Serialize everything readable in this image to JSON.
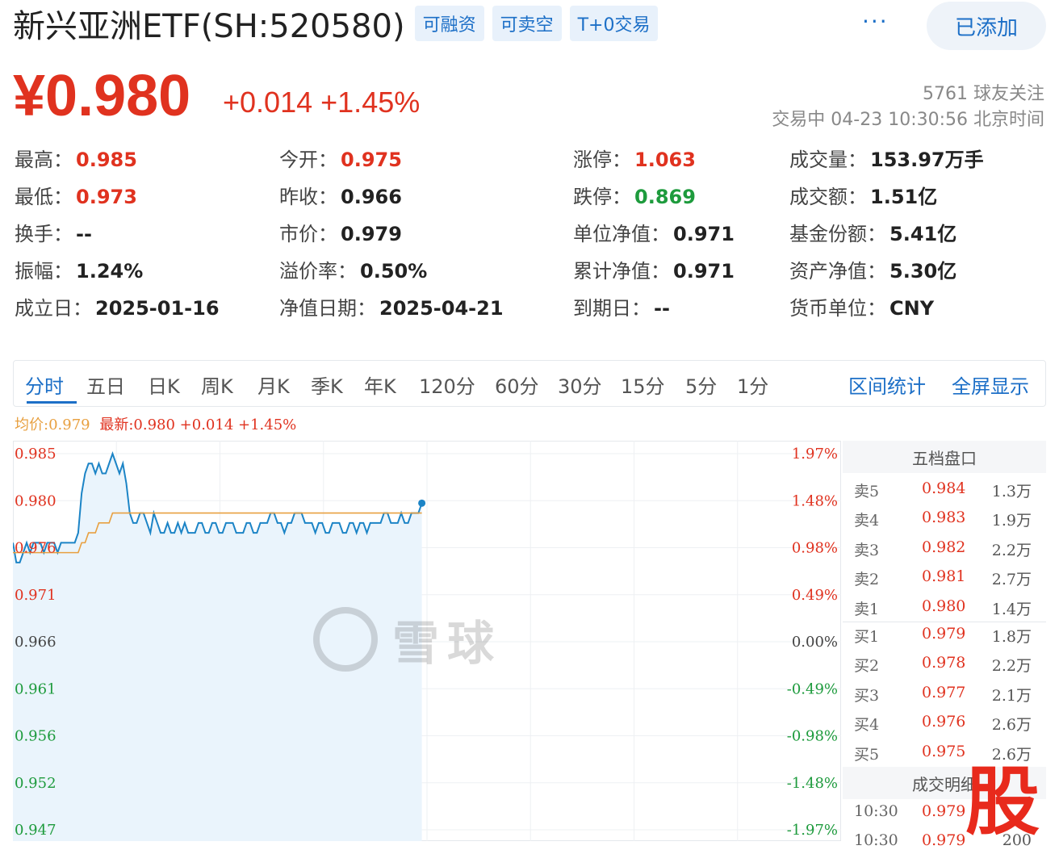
{
  "header": {
    "title": "新兴亚洲ETF(SH:520580)",
    "tags": [
      "可融资",
      "可卖空",
      "T+0交易"
    ],
    "more_label": "···",
    "follow_label": "已添加"
  },
  "quote": {
    "price": "¥0.980",
    "change": "+0.014",
    "change_pct": "+1.45%",
    "followers": "5761 球友关注",
    "status": "交易中 04-23 10:30:56 北京时间"
  },
  "stats": [
    {
      "label": "最高：",
      "value": "0.985",
      "tone": "red"
    },
    {
      "label": "今开：",
      "value": "0.975",
      "tone": "red"
    },
    {
      "label": "涨停：",
      "value": "1.063",
      "tone": "red"
    },
    {
      "label": "成交量：",
      "value": "153.97万手",
      "tone": ""
    },
    {
      "label": "最低：",
      "value": "0.973",
      "tone": "red"
    },
    {
      "label": "昨收：",
      "value": "0.966",
      "tone": ""
    },
    {
      "label": "跌停：",
      "value": "0.869",
      "tone": "green"
    },
    {
      "label": "成交额：",
      "value": "1.51亿",
      "tone": ""
    },
    {
      "label": "换手：",
      "value": "--",
      "tone": ""
    },
    {
      "label": "市价：",
      "value": "0.979",
      "tone": ""
    },
    {
      "label": "单位净值：",
      "value": "0.971",
      "tone": ""
    },
    {
      "label": "基金份额：",
      "value": "5.41亿",
      "tone": ""
    },
    {
      "label": "振幅：",
      "value": "1.24%",
      "tone": ""
    },
    {
      "label": "溢价率：",
      "value": "0.50%",
      "tone": ""
    },
    {
      "label": "累计净值：",
      "value": "0.971",
      "tone": ""
    },
    {
      "label": "资产净值：",
      "value": "5.30亿",
      "tone": ""
    },
    {
      "label": "成立日：",
      "value": "2025-01-16",
      "tone": ""
    },
    {
      "label": "净值日期：",
      "value": "2025-04-21",
      "tone": ""
    },
    {
      "label": "到期日：",
      "value": "--",
      "tone": ""
    },
    {
      "label": "货币单位：",
      "value": "CNY",
      "tone": ""
    }
  ],
  "tabs": [
    "分时",
    "五日",
    "日K",
    "周K",
    "月K",
    "季K",
    "年K",
    "120分",
    "60分",
    "30分",
    "15分",
    "5分",
    "1分"
  ],
  "active_tab": "分时",
  "right_tabs": [
    "区间统计",
    "全屏显示"
  ],
  "legend": {
    "avg": "均价:0.979",
    "latest": "最新:0.980 +0.014 +1.45%"
  },
  "chart_data": {
    "type": "line",
    "y_ticks_left": [
      "0.985",
      "0.980",
      "0.976",
      "0.971",
      "0.966",
      "0.961",
      "0.956",
      "0.952",
      "0.947"
    ],
    "y_ticks_right": [
      "1.97%",
      "1.48%",
      "0.98%",
      "0.49%",
      "0.00%",
      "-0.49%",
      "-0.98%",
      "-1.48%",
      "-1.97%"
    ],
    "ylim": [
      0.947,
      0.985
    ],
    "xlim": [
      0,
      241
    ],
    "baseline": 0.966,
    "tick_colors": {
      "up": "#e0321f",
      "flat": "#444444",
      "down": "#1e9b3d"
    },
    "series": [
      {
        "name": "最新",
        "color": "#1c84c6",
        "values": [
          0.976,
          0.974,
          0.974,
          0.975,
          0.976,
          0.975,
          0.976,
          0.976,
          0.976,
          0.975,
          0.976,
          0.976,
          0.976,
          0.975,
          0.976,
          0.976,
          0.976,
          0.976,
          0.976,
          0.977,
          0.981,
          0.983,
          0.984,
          0.984,
          0.983,
          0.984,
          0.983,
          0.983,
          0.984,
          0.985,
          0.984,
          0.983,
          0.984,
          0.982,
          0.979,
          0.978,
          0.978,
          0.979,
          0.979,
          0.978,
          0.977,
          0.979,
          0.978,
          0.977,
          0.977,
          0.978,
          0.977,
          0.977,
          0.978,
          0.977,
          0.978,
          0.977,
          0.977,
          0.977,
          0.978,
          0.978,
          0.977,
          0.977,
          0.978,
          0.978,
          0.977,
          0.977,
          0.978,
          0.978,
          0.978,
          0.977,
          0.977,
          0.977,
          0.978,
          0.978,
          0.977,
          0.977,
          0.978,
          0.978,
          0.978,
          0.979,
          0.979,
          0.978,
          0.978,
          0.977,
          0.978,
          0.978,
          0.979,
          0.979,
          0.979,
          0.978,
          0.978,
          0.978,
          0.977,
          0.978,
          0.978,
          0.977,
          0.977,
          0.978,
          0.978,
          0.978,
          0.977,
          0.977,
          0.978,
          0.978,
          0.977,
          0.978,
          0.978,
          0.977,
          0.978,
          0.978,
          0.978,
          0.978,
          0.979,
          0.979,
          0.978,
          0.978,
          0.978,
          0.979,
          0.978,
          0.978,
          0.979,
          0.979,
          0.979,
          0.98
        ]
      },
      {
        "name": "均价",
        "color": "#e8a040",
        "values": [
          0.975,
          0.975,
          0.975,
          0.975,
          0.975,
          0.975,
          0.975,
          0.975,
          0.975,
          0.975,
          0.975,
          0.975,
          0.975,
          0.975,
          0.975,
          0.975,
          0.975,
          0.975,
          0.975,
          0.975,
          0.976,
          0.976,
          0.977,
          0.977,
          0.977,
          0.978,
          0.978,
          0.978,
          0.978,
          0.979,
          0.979,
          0.979,
          0.979,
          0.979,
          0.979,
          0.979,
          0.979,
          0.979,
          0.979,
          0.979,
          0.979,
          0.979,
          0.979,
          0.979,
          0.979,
          0.979,
          0.979,
          0.979,
          0.979,
          0.979,
          0.979,
          0.979,
          0.979,
          0.979,
          0.979,
          0.979,
          0.979,
          0.979,
          0.979,
          0.979,
          0.979,
          0.979,
          0.979,
          0.979,
          0.979,
          0.979,
          0.979,
          0.979,
          0.979,
          0.979,
          0.979,
          0.979,
          0.979,
          0.979,
          0.979,
          0.979,
          0.979,
          0.979,
          0.979,
          0.979,
          0.979,
          0.979,
          0.979,
          0.979,
          0.979,
          0.979,
          0.979,
          0.979,
          0.979,
          0.979,
          0.979,
          0.979,
          0.979,
          0.979,
          0.979,
          0.979,
          0.979,
          0.979,
          0.979,
          0.979,
          0.979,
          0.979,
          0.979,
          0.979,
          0.979,
          0.979,
          0.979,
          0.979,
          0.979,
          0.979,
          0.979,
          0.979,
          0.979,
          0.979,
          0.979,
          0.979,
          0.979,
          0.979,
          0.979,
          0.979
        ]
      }
    ]
  },
  "watermark": {
    "text": "雪球"
  },
  "order_book": {
    "title": "五档盘口",
    "asks": [
      {
        "label": "卖5",
        "price": "0.984",
        "vol": "1.3万"
      },
      {
        "label": "卖4",
        "price": "0.983",
        "vol": "1.9万"
      },
      {
        "label": "卖3",
        "price": "0.982",
        "vol": "2.2万"
      },
      {
        "label": "卖2",
        "price": "0.981",
        "vol": "2.7万"
      },
      {
        "label": "卖1",
        "price": "0.980",
        "vol": "1.4万"
      }
    ],
    "bids": [
      {
        "label": "买1",
        "price": "0.979",
        "vol": "1.8万"
      },
      {
        "label": "买2",
        "price": "0.978",
        "vol": "2.2万"
      },
      {
        "label": "买3",
        "price": "0.977",
        "vol": "2.1万"
      },
      {
        "label": "买4",
        "price": "0.976",
        "vol": "2.6万"
      },
      {
        "label": "买5",
        "price": "0.975",
        "vol": "2.6万"
      }
    ],
    "detail_title": "成交明细",
    "trades": [
      {
        "time": "10:30",
        "price": "0.979",
        "vol": ""
      },
      {
        "time": "10:30",
        "price": "0.979",
        "vol": "200"
      }
    ]
  },
  "stamp": "股",
  "colors": {
    "up": "#e0321f",
    "down": "#1e9b3d",
    "accent": "#1c6fc7"
  }
}
